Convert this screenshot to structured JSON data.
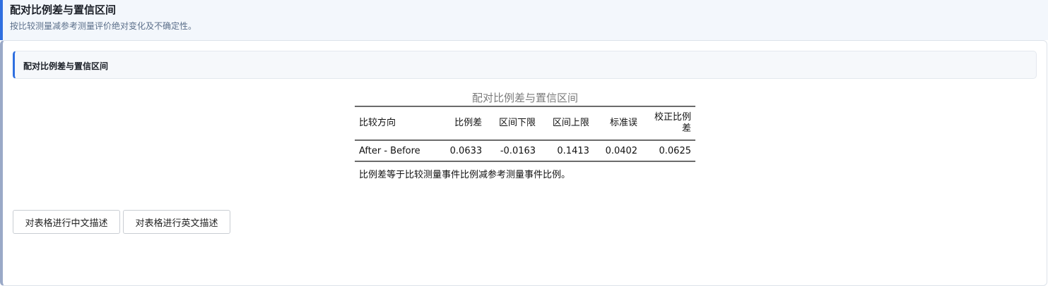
{
  "header": {
    "title": "配对比例差与置信区间",
    "subtitle": "按比较测量减参考测量评价绝对变化及不确定性。"
  },
  "section": {
    "title": "配对比例差与置信区间"
  },
  "table": {
    "caption": "配对比例差与置信区间",
    "columns": {
      "direction": "比较方向",
      "diff": "比例差",
      "lower": "区间下限",
      "upper": "区间上限",
      "se": "标准误",
      "corrected_line1": "校正比例",
      "corrected_line2": "差"
    },
    "rows": [
      {
        "direction": "After - Before",
        "diff": "0.0633",
        "lower": "-0.0163",
        "upper": "0.1413",
        "se": "0.0402",
        "corrected": "0.0625"
      }
    ],
    "note": "比例差等于比较测量事件比例减参考测量事件比例。"
  },
  "buttons": {
    "describe_cn": "对表格进行中文描述",
    "describe_en": "对表格进行英文描述"
  }
}
